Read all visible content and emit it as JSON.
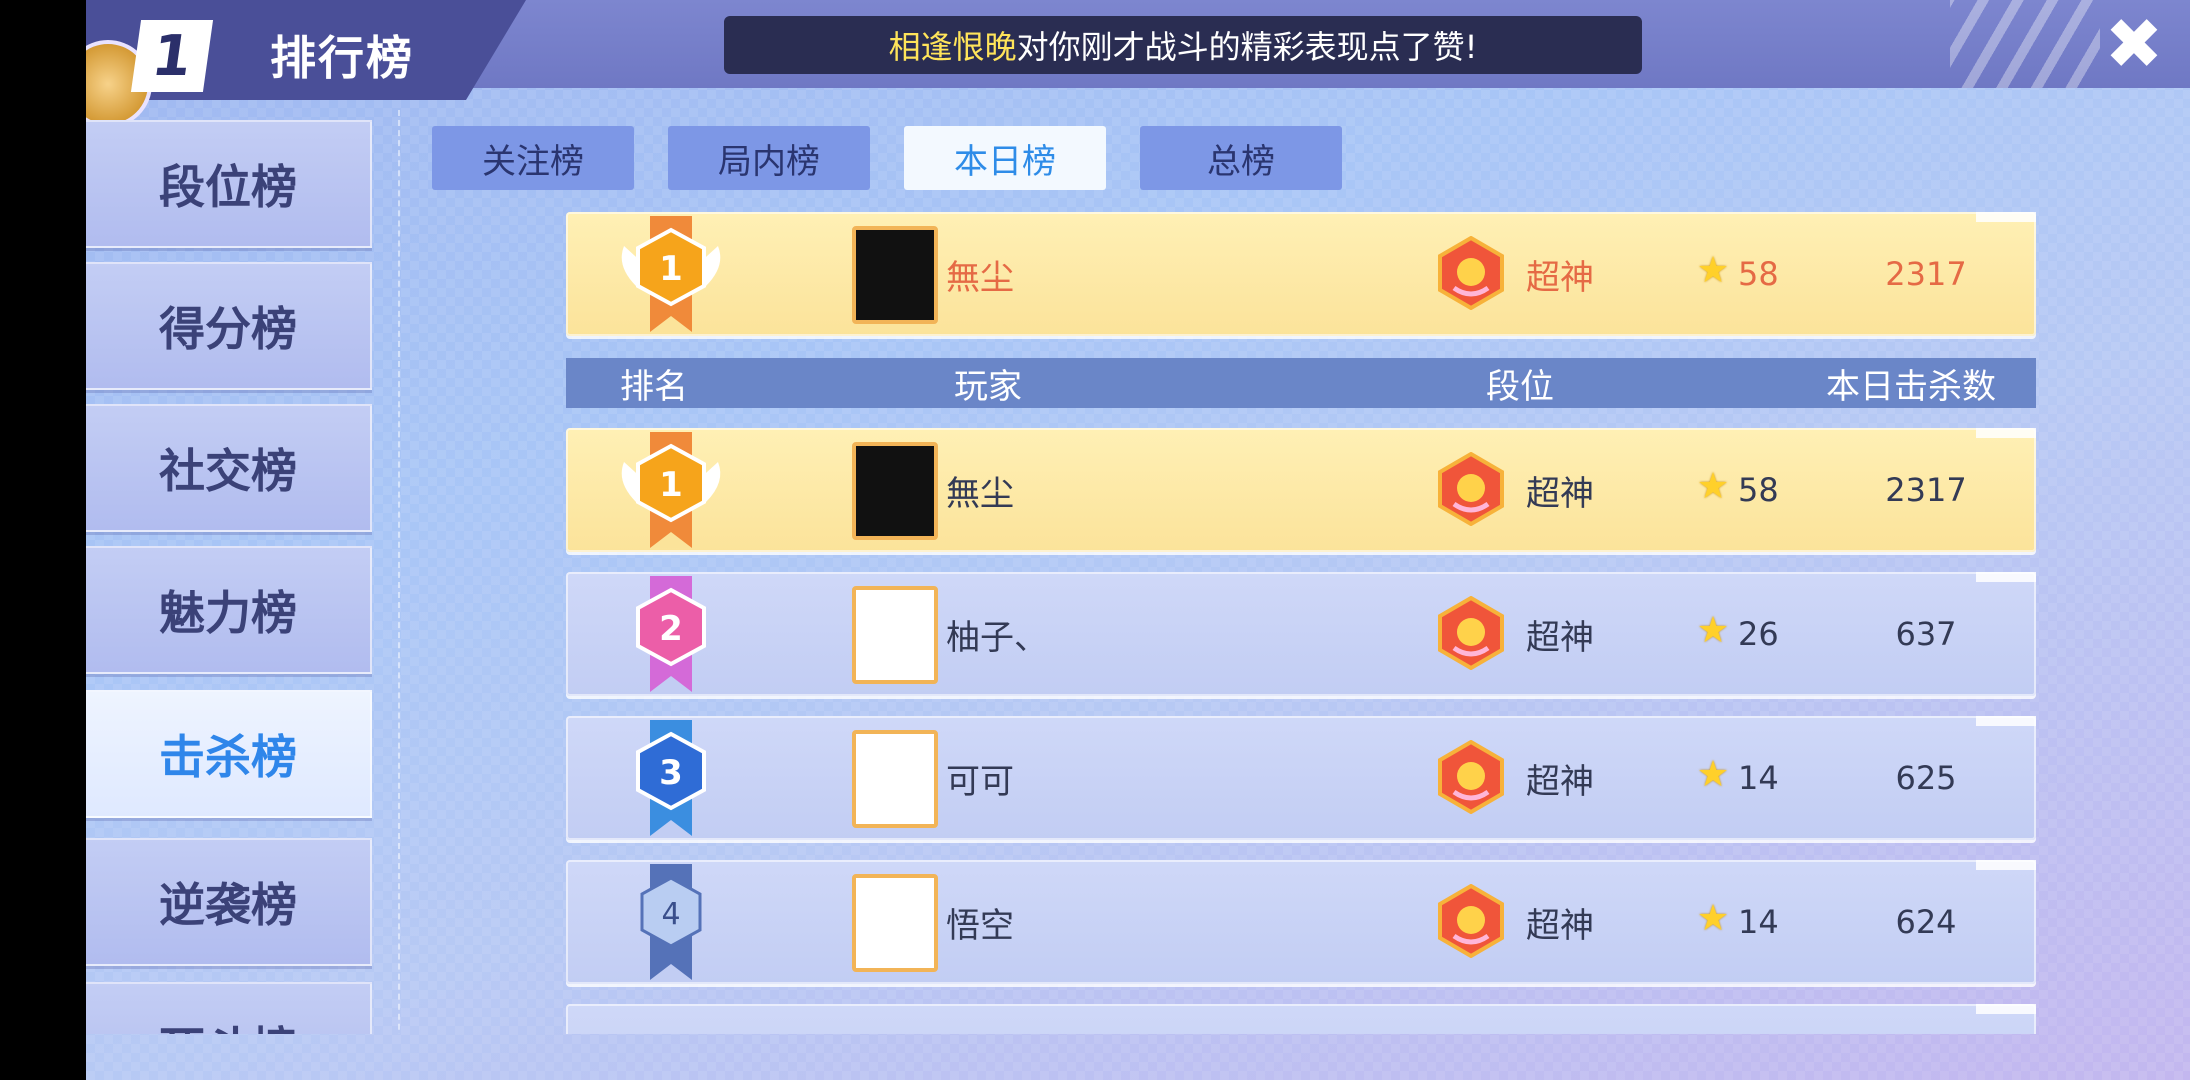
{
  "header": {
    "rank_number": "1",
    "title": "排行榜",
    "notice_highlight": "相逢恨晚",
    "notice_text": "对你刚才战斗的精彩表现点了赞!",
    "close_label": "✖"
  },
  "sidebar": {
    "items": [
      {
        "label": "段位榜"
      },
      {
        "label": "得分榜"
      },
      {
        "label": "社交榜"
      },
      {
        "label": "魅力榜"
      },
      {
        "label": "击杀榜"
      },
      {
        "label": "逆袭榜"
      },
      {
        "label": "死斗榜"
      }
    ]
  },
  "tabs": [
    {
      "label": "关注榜"
    },
    {
      "label": "局内榜"
    },
    {
      "label": "本日榜"
    },
    {
      "label": "总榜"
    }
  ],
  "my_rank": {
    "rank": "1",
    "player": "無尘",
    "tier": "超神",
    "stars": "58",
    "kills": "2317"
  },
  "table": {
    "columns": [
      "排名",
      "玩家",
      "段位",
      "本日击杀数"
    ],
    "rows": [
      {
        "rank": "1",
        "player": "無尘",
        "tier": "超神",
        "stars": "58",
        "kills": "2317"
      },
      {
        "rank": "2",
        "player": "柚子、",
        "tier": "超神",
        "stars": "26",
        "kills": "637"
      },
      {
        "rank": "3",
        "player": "可可",
        "tier": "超神",
        "stars": "14",
        "kills": "625"
      },
      {
        "rank": "4",
        "player": "悟空",
        "tier": "超神",
        "stars": "14",
        "kills": "624"
      }
    ]
  },
  "colors": {
    "gold_row": "#fbe39a",
    "normal_row": "#c2cdf3",
    "accent_blue": "#2e8ce8",
    "top_text": "#e56a45",
    "notice_highlight": "#ffe45a"
  },
  "icons": {
    "close": "close-icon",
    "star": "star-icon",
    "tier": "super-god-tier-icon",
    "rank1": "gold-rank-badge-icon",
    "rank2": "pink-rank-badge-icon",
    "rank3": "blue-rank-badge-icon",
    "rank4": "silver-rank-badge-icon"
  }
}
